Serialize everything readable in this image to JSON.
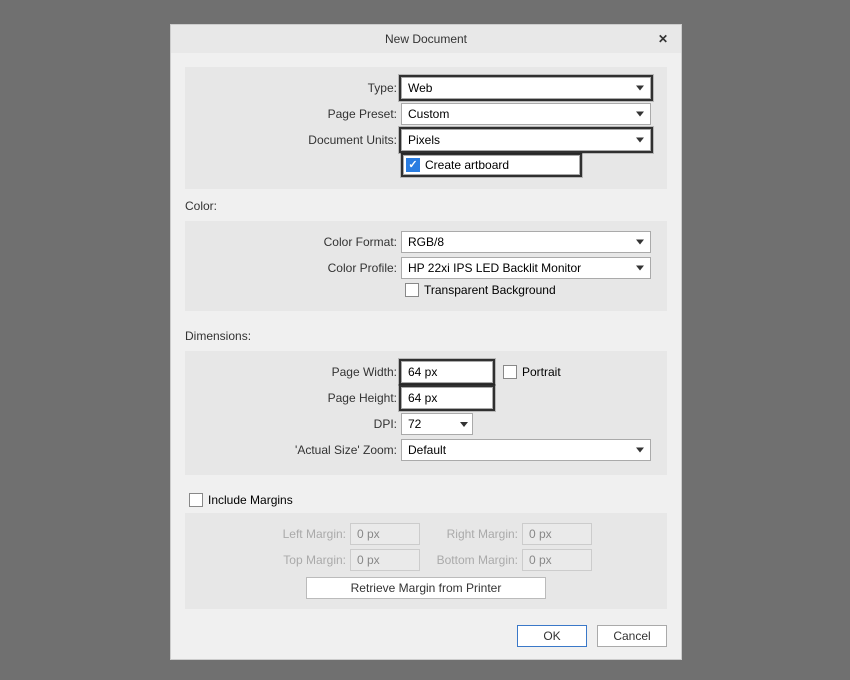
{
  "dialog": {
    "title": "New Document",
    "close_glyph": "✕"
  },
  "top": {
    "type_label": "Type:",
    "type_value": "Web",
    "preset_label": "Page Preset:",
    "preset_value": "Custom",
    "units_label": "Document Units:",
    "units_value": "Pixels",
    "create_artboard_label": "Create artboard",
    "create_artboard_checked": true
  },
  "color": {
    "section_label": "Color:",
    "format_label": "Color Format:",
    "format_value": "RGB/8",
    "profile_label": "Color Profile:",
    "profile_value": "HP 22xi IPS LED Backlit Monitor",
    "transparent_label": "Transparent Background",
    "transparent_checked": false
  },
  "dimensions": {
    "section_label": "Dimensions:",
    "width_label": "Page Width:",
    "width_value": "64 px",
    "height_label": "Page Height:",
    "height_value": "64 px",
    "dpi_label": "DPI:",
    "dpi_value": "72",
    "portrait_label": "Portrait",
    "portrait_checked": false,
    "zoom_label": "'Actual Size' Zoom:",
    "zoom_value": "Default"
  },
  "margins": {
    "include_label": "Include Margins",
    "include_checked": false,
    "left_label": "Left Margin:",
    "left_value": "0 px",
    "right_label": "Right Margin:",
    "right_value": "0 px",
    "top_label": "Top Margin:",
    "top_value": "0 px",
    "bottom_label": "Bottom Margin:",
    "bottom_value": "0 px",
    "retrieve_label": "Retrieve Margin from Printer"
  },
  "footer": {
    "ok": "OK",
    "cancel": "Cancel"
  }
}
